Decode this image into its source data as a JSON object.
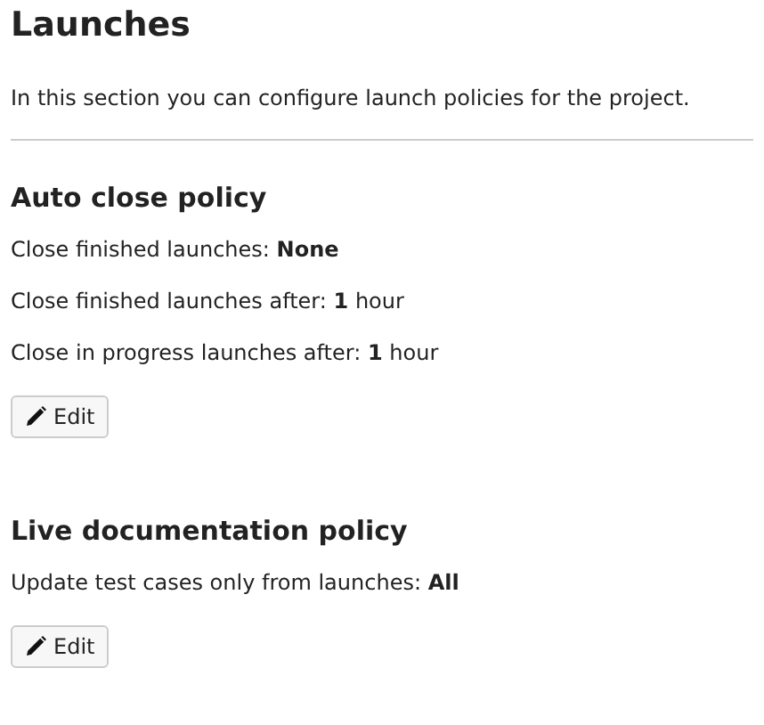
{
  "title": "Launches",
  "description": "In this section you can configure launch policies for the project.",
  "sections": [
    {
      "heading": "Auto close policy",
      "settings": [
        "Close finished launches: **None**",
        "Close finished launches after: **1** hour",
        "Close in progress launches after: **1** hour"
      ],
      "button": "Edit"
    },
    {
      "heading": "Live documentation policy",
      "settings": [
        "Update test cases only from launches: **All**"
      ],
      "button": "Edit"
    }
  ]
}
